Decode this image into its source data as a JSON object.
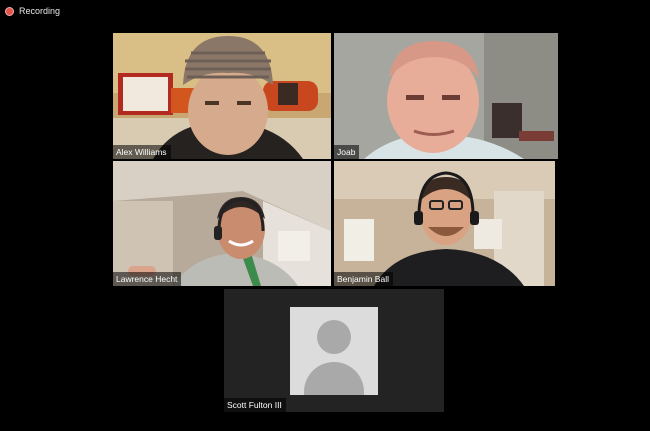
{
  "recording": {
    "label": "Recording"
  },
  "participants": [
    {
      "name": "Alex Williams"
    },
    {
      "name": "Joab"
    },
    {
      "name": "Lawrence Hecht"
    },
    {
      "name": "Benjamin Ball"
    },
    {
      "name": "Scott Fulton III"
    }
  ],
  "colors": {
    "active_speaker_border": "#c9dc61",
    "recording_dot": "#e5534b",
    "background": "#000000"
  }
}
